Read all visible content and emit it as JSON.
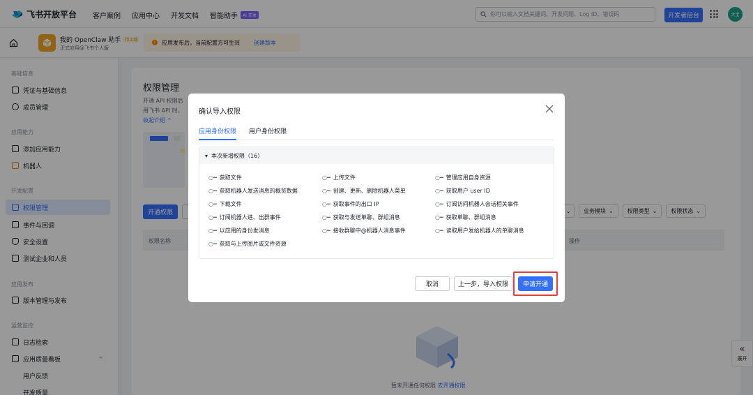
{
  "topnav": {
    "brand": "飞书开放平台",
    "links": [
      "客户案例",
      "应用中心",
      "开发文档",
      "智能助手"
    ],
    "ai_badge": "AI 开发",
    "search_placeholder": "你可以输入文档关键词、开发问题、Log ID、错误码",
    "dev_console": "开发者后台",
    "avatar_text": "大宝"
  },
  "appbar": {
    "app_name": "我的 OpenClaw 助手",
    "status": "待上线",
    "app_sub": "正式应用@飞书个人版",
    "notice": "应用发布后，当前配置方可生效",
    "notice_link": "创建版本"
  },
  "sidebar": {
    "sections": [
      "基础信息",
      "应用能力",
      "开发配置",
      "应用发布",
      "运营监控"
    ],
    "items": [
      "凭证与基础信息",
      "成员管理",
      "添加应用能力",
      "机器人",
      "权限管理",
      "事件与回调",
      "安全设置",
      "测试企业和人员",
      "版本管理与发布",
      "日志检索",
      "应用质量看板",
      "用户反馈",
      "开发质量"
    ]
  },
  "main": {
    "title": "权限管理",
    "desc1": "开通 API 权限后",
    "desc2": "用飞书 API 时，",
    "collapse": "收起介绍 ^",
    "open_btn": "开通权限",
    "filters": [
      "业务模块",
      "权限类型",
      "权限状态"
    ],
    "th_name": "权限名称",
    "th_op": "操作",
    "empty_text": "暂未开通任何权限",
    "empty_link": "去开通权限",
    "expand": "展开"
  },
  "modal": {
    "title": "确认导入权限",
    "tabs": [
      "应用身份权限",
      "用户身份权限"
    ],
    "box_header": "本次新增权限（16）",
    "permissions": [
      "获取文件",
      "上传文件",
      "管理应用自身资源",
      "获取机器人发送消息的概览数据",
      "创建、更新、删除机器人菜单",
      "获取用户 user ID",
      "下载文件",
      "获取事件的出口 IP",
      "订阅访问机器人会话相关事件",
      "订阅机器人进、出群事件",
      "获取与发送单聊、群组消息",
      "获取单聊、群组消息",
      "以应用的身份发消息",
      "接收群聊中@机器人消息事件",
      "读取用户发给机器人的单聊消息",
      "获取与上传图片或文件资源"
    ],
    "cancel": "取消",
    "back": "上一步，导入权限",
    "apply": "申请开通"
  },
  "colors": {
    "accent": "#3370ff",
    "highlight": "#e43f3f"
  }
}
